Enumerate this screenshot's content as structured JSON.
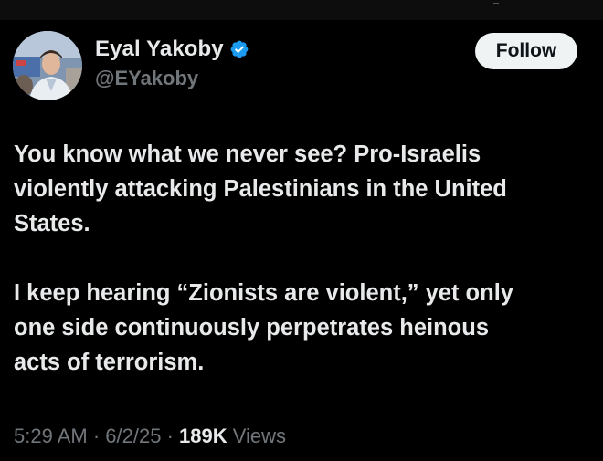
{
  "author": {
    "display_name": "Eyal Yakoby",
    "handle": "@EYakoby",
    "verified": true
  },
  "follow_button": {
    "label": "Follow"
  },
  "tweet": {
    "paragraphs": [
      "You know what we never see? Pro-Israelis\nviolently attacking Palestinians in the United\nStates.",
      "I keep hearing “Zionists are violent,” yet only\none side continuously perpetrates heinous\nacts of terrorism."
    ]
  },
  "meta": {
    "time": "5:29 AM",
    "separator": " · ",
    "date": "6/2/25",
    "views_count": "189K",
    "views_label": "Views"
  },
  "colors": {
    "background": "#000000",
    "primary_text": "#e7e9ea",
    "secondary_text": "#71767b",
    "verified_badge": "#1d9bf0",
    "follow_button_bg": "#eff3f4",
    "follow_button_text": "#0f1419"
  },
  "icons": {
    "verified": "verified-badge-icon"
  }
}
